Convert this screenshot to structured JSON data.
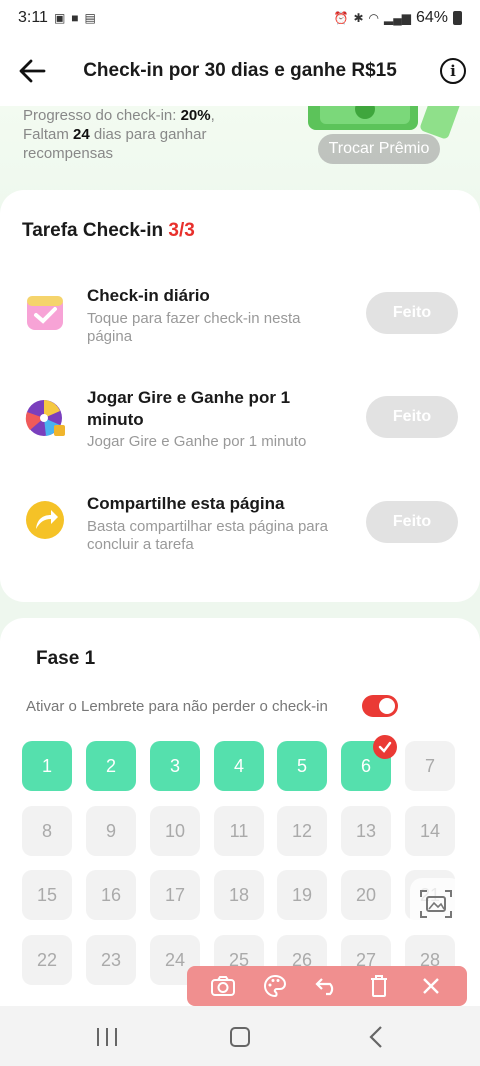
{
  "status_bar": {
    "time": "3:11",
    "battery": "64%"
  },
  "header": {
    "title": "Check-in por 30 dias e ganhe R$15"
  },
  "banner": {
    "progress_label": "Progresso do check-in: ",
    "progress_value": "20%",
    "remaining_prefix": ", Faltam ",
    "remaining_days": "24",
    "remaining_suffix": " dias para ganhar recompensas",
    "exchange_label": "Trocar Prêmio"
  },
  "tasks": {
    "title": "Tarefa Check-in ",
    "progress": "3/3",
    "items": [
      {
        "name": "Check-in diário",
        "desc": "Toque para fazer check-in nesta página",
        "button": "Feito"
      },
      {
        "name": "Jogar Gire e Ganhe por 1 minuto",
        "desc": "Jogar Gire e Ganhe por 1 minuto",
        "button": "Feito"
      },
      {
        "name": "Compartilhe esta página",
        "desc": "Basta compartilhar esta página para concluir a tarefa",
        "button": "Feito"
      }
    ]
  },
  "phase": {
    "title": "Fase 1",
    "reminder": "Ativar o Lembrete para não perder o check-in",
    "reminder_on": true,
    "days": [
      "1",
      "2",
      "3",
      "4",
      "5",
      "6",
      "7",
      "8",
      "9",
      "10",
      "11",
      "12",
      "13",
      "14",
      "15",
      "16",
      "17",
      "18",
      "19",
      "20",
      "21",
      "22",
      "23",
      "24",
      "25",
      "26",
      "27",
      "28"
    ],
    "completed_days": 6
  },
  "colors": {
    "accent_red": "#ea3a35",
    "done_green": "#55e0ad"
  }
}
